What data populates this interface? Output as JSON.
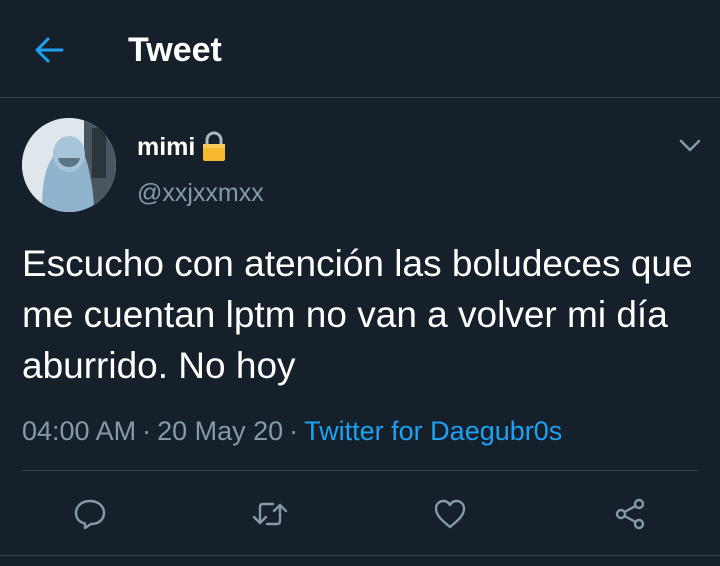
{
  "header": {
    "title": "Tweet",
    "back_icon": "arrow-left-icon"
  },
  "author": {
    "display_name": "mimi",
    "handle": "@xxjxxmxx",
    "badge_icon": "lock-icon",
    "avatar_icon": "avatar-photo"
  },
  "tweet": {
    "text": "Escucho con atención las boludeces que me cuentan lptm no van a volver mi día aburrido. No hoy",
    "time": "04:00 AM",
    "separator": "·",
    "date": "20 May 20",
    "source": "Twitter for Daegubr0s"
  },
  "actions": {
    "reply_icon": "reply-icon",
    "retweet_icon": "retweet-icon",
    "like_icon": "heart-icon",
    "share_icon": "share-icon"
  },
  "colors": {
    "background": "#15202b",
    "accent": "#1da1f2",
    "secondary_text": "#8899a6",
    "divider": "#38444d"
  }
}
